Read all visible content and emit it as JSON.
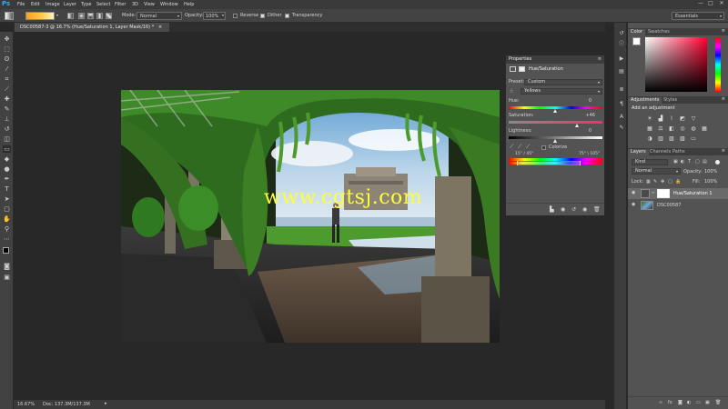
{
  "app": {
    "logo": "Ps"
  },
  "menubar": {
    "items": [
      "File",
      "Edit",
      "Image",
      "Layer",
      "Type",
      "Select",
      "Filter",
      "3D",
      "View",
      "Window",
      "Help"
    ],
    "window_buttons": [
      "—",
      "□",
      "✕"
    ]
  },
  "options_bar": {
    "mode_label": "Mode:",
    "mode_value": "Normal",
    "opacity_label": "Opacity:",
    "opacity_value": "100%",
    "reverse_label": "Reverse",
    "dither_label": "Dither",
    "transparency_label": "Transparency",
    "workspace_value": "Essentials"
  },
  "document": {
    "tab_title": "DSC00587-3 @ 16.7% (Hue/Saturation 1, Layer Mask/16) *",
    "tab_close": "×",
    "zoom": "16.67%",
    "doc_info": "Doc: 137.3M/137.3M",
    "watermark": "www.cgtsj.com"
  },
  "properties": {
    "title": "Properties",
    "adjustment_name": "Hue/Saturation",
    "preset_label": "Preset:",
    "preset_value": "Custom",
    "channel_value": "Yellows",
    "hue_label": "Hue:",
    "hue_value": "0",
    "hue_level": 0.5,
    "saturation_label": "Saturation:",
    "saturation_value": "+46",
    "saturation_level": 0.73,
    "lightness_label": "Lightness:",
    "lightness_value": "0",
    "lightness_level": 0.5,
    "colorize_label": "Colorize",
    "range_left": "15° / 45°",
    "range_right": "75° \\ 105°"
  },
  "color_panel": {
    "tabs": [
      "Color",
      "Swatches"
    ]
  },
  "adjustments_panel": {
    "tabs": [
      "Adjustments",
      "Styles"
    ],
    "subtitle": "Add an adjustment"
  },
  "layers_panel": {
    "tabs": [
      "Layers",
      "Channels",
      "Paths"
    ],
    "kind_value": "Kind",
    "blend_value": "Normal",
    "opacity_label": "Opacity:",
    "opacity_value": "100%",
    "lock_label": "Lock:",
    "fill_label": "Fill:",
    "fill_value": "100%",
    "layers": [
      {
        "name": "Hue/Saturation 1"
      },
      {
        "name": "DSC00587"
      }
    ]
  },
  "colors": {
    "panel_bg": "#535353",
    "watermark": "#ffff33",
    "accent": "#31a8ff"
  }
}
